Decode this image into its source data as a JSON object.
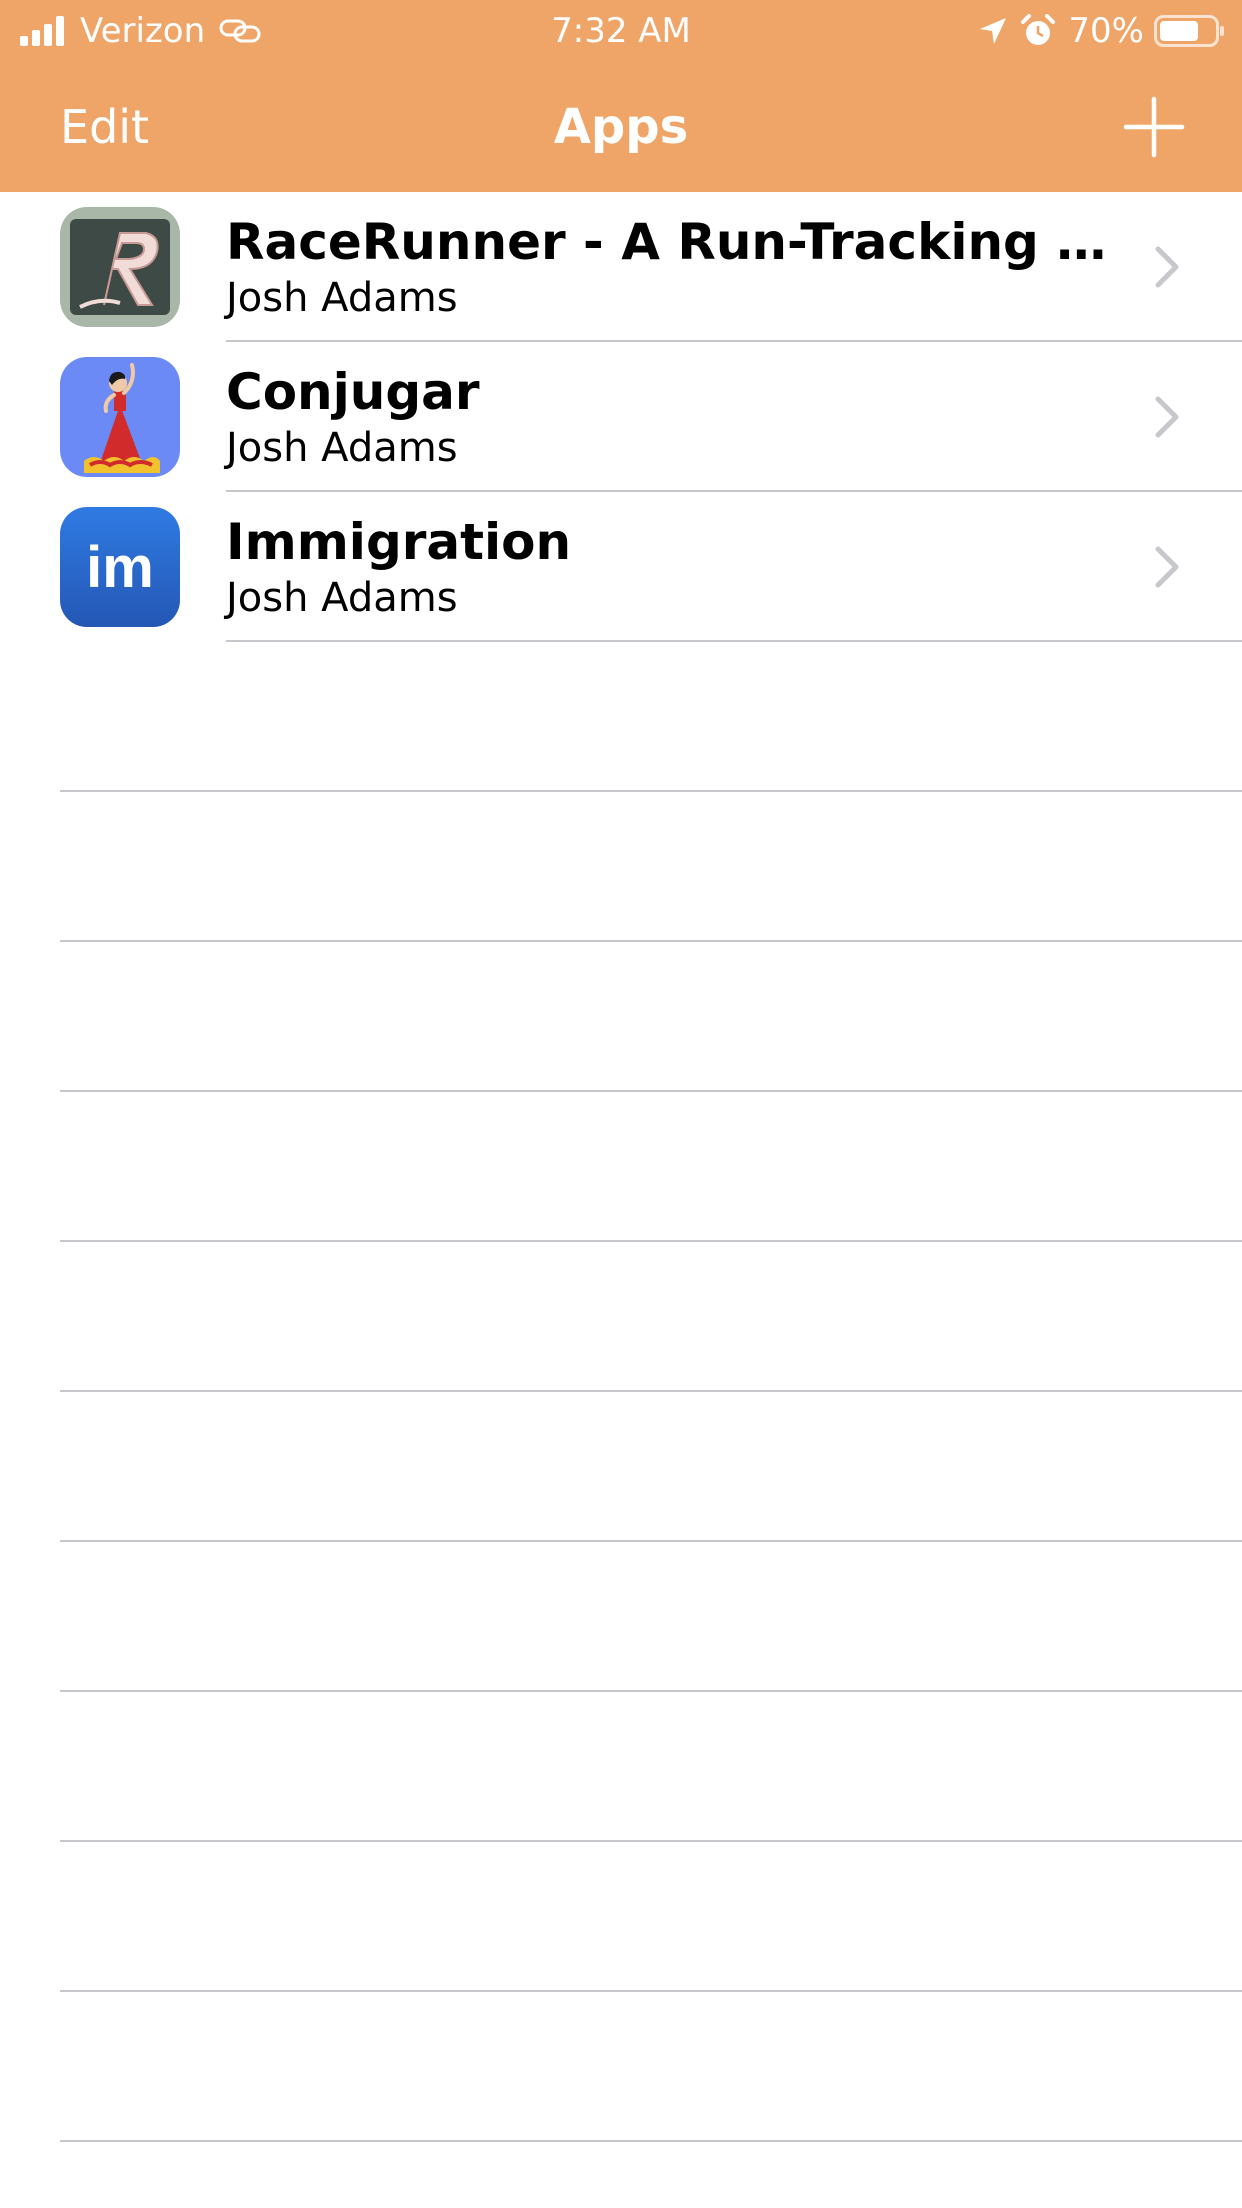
{
  "status_bar": {
    "carrier": "Verizon",
    "time": "7:32 AM",
    "battery_percent": "70%",
    "icons": [
      "signal-icon",
      "link-icon",
      "location-icon",
      "alarm-icon",
      "battery-icon"
    ]
  },
  "nav": {
    "edit_label": "Edit",
    "title": "Apps",
    "add_icon": "plus-icon"
  },
  "apps": [
    {
      "title": "RaceRunner - A Run-Tracking App f...",
      "developer": "Josh Adams",
      "icon": "racerunner-app-icon"
    },
    {
      "title": "Conjugar",
      "developer": "Josh Adams",
      "icon": "conjugar-app-icon"
    },
    {
      "title": "Immigration",
      "developer": "Josh Adams",
      "icon": "immigration-app-icon",
      "icon_text": "im"
    }
  ],
  "colors": {
    "nav_background": "#EFA567",
    "nav_text": "#FFFFFF",
    "separator": "#C8C7CC",
    "chevron": "#C7C7CC"
  }
}
